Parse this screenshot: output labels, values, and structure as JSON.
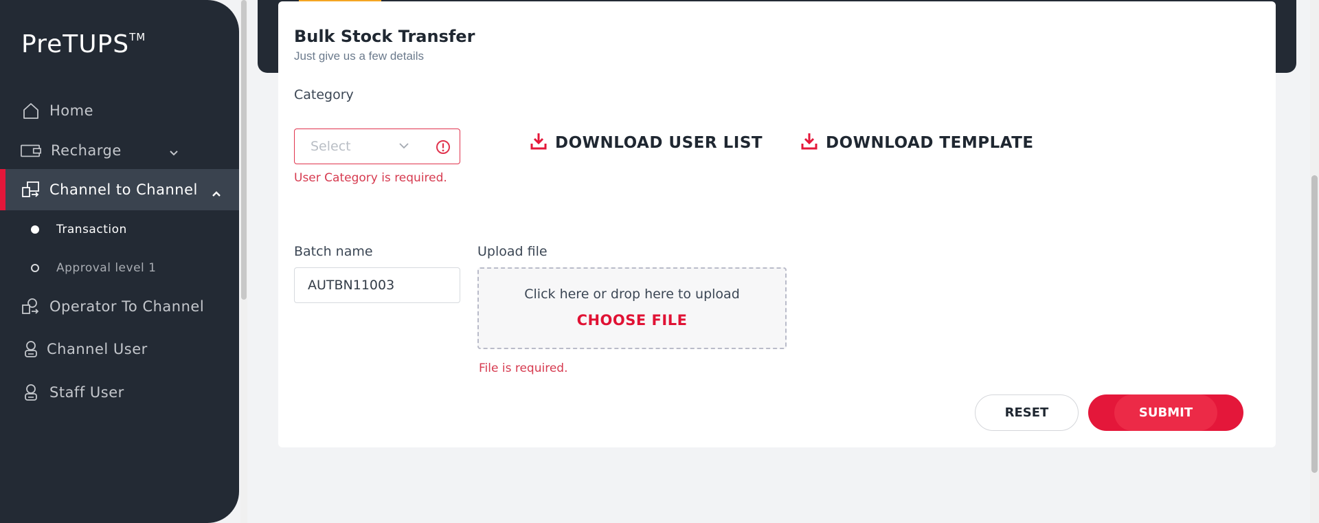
{
  "app": {
    "title": "PreTUPS",
    "trademark": "TM"
  },
  "sidebar": {
    "items": [
      {
        "label": "Home",
        "icon": "home-icon"
      },
      {
        "label": "Recharge",
        "icon": "wallet-icon"
      },
      {
        "label": "Channel to Channel",
        "icon": "transfer-icon"
      },
      {
        "label": "Operator To Channel",
        "icon": "operator-transfer-icon"
      },
      {
        "label": "Channel User",
        "icon": "user-icon"
      },
      {
        "label": "Staff User",
        "icon": "user-icon"
      }
    ],
    "subitems": [
      {
        "label": "Transaction"
      },
      {
        "label": "Approval level 1"
      }
    ]
  },
  "form": {
    "title": "Bulk Stock Transfer",
    "subtitle": "Just give us a few details",
    "category_label": "Category",
    "category_placeholder": "Select",
    "category_error": "User Category is required.",
    "download_user_list": "DOWNLOAD USER LIST",
    "download_template": "DOWNLOAD TEMPLATE",
    "batch_label": "Batch name",
    "batch_value": "AUTBN11003",
    "upload_label": "Upload file",
    "upload_hint": "Click here or drop here to upload",
    "choose_file": "CHOOSE FILE",
    "file_error": "File is required.",
    "reset": "RESET",
    "submit": "SUBMIT"
  },
  "colors": {
    "accent": "#e4173a",
    "sidebar": "#232a34",
    "error": "#d63a4f",
    "tab_accent": "#f5a623"
  }
}
